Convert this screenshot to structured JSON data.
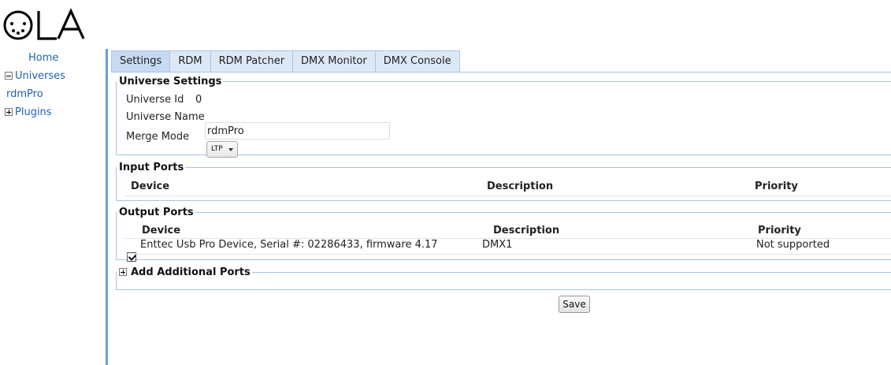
{
  "logo": {
    "text": "OLA"
  },
  "nav": {
    "home": "Home",
    "universes": "Universes",
    "universe_item": "rdmPro",
    "plugins": "Plugins"
  },
  "tabs": [
    {
      "label": "Settings",
      "active": true
    },
    {
      "label": "RDM",
      "active": false
    },
    {
      "label": "RDM Patcher",
      "active": false
    },
    {
      "label": "DMX Monitor",
      "active": false
    },
    {
      "label": "DMX Console",
      "active": false
    }
  ],
  "settings": {
    "legend": "Universe Settings",
    "id_label": "Universe Id",
    "id_value": "0",
    "name_label": "Universe Name",
    "name_value": "rdmPro",
    "merge_label": "Merge Mode",
    "merge_value": "LTP"
  },
  "input_ports": {
    "legend": "Input Ports",
    "headers": {
      "device": "Device",
      "description": "Description",
      "priority": "Priority"
    }
  },
  "output_ports": {
    "legend": "Output Ports",
    "headers": {
      "device": "Device",
      "description": "Description",
      "priority": "Priority"
    },
    "rows": [
      {
        "checked": true,
        "device": "Enttec Usb Pro Device, Serial #: 02286433, firmware 4.17",
        "description": "DMX1",
        "priority": "Not supported"
      }
    ]
  },
  "add_ports": {
    "legend": "Add Additional Ports"
  },
  "save_label": "Save",
  "colors": {
    "link": "#1f62b0",
    "accent_border": "#6a9ed8",
    "tab_bg": "#dde8f6",
    "tab_active_bg": "#c6daf2"
  }
}
